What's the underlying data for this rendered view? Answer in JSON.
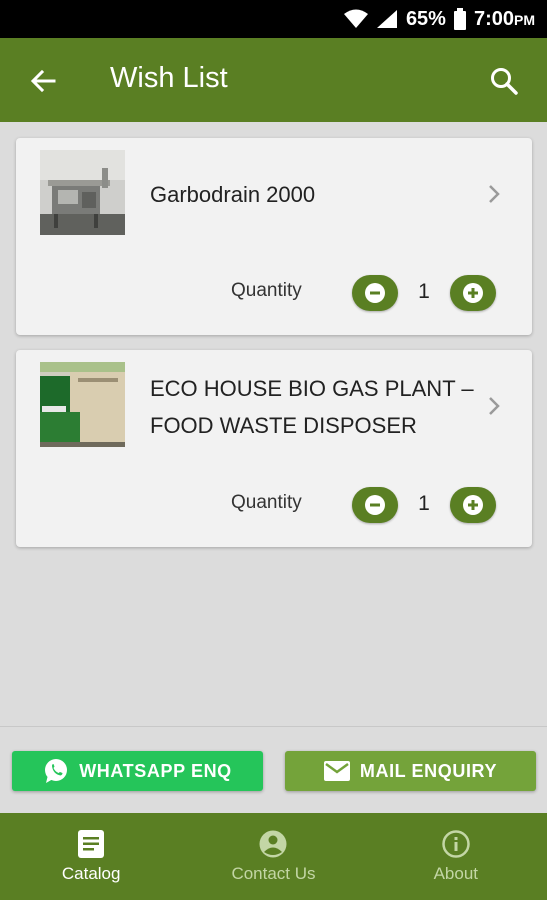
{
  "status_bar": {
    "battery": "65%",
    "time": "7:00",
    "ampm": "PM"
  },
  "app_bar": {
    "title": "Wish List"
  },
  "items": [
    {
      "name": "Garbodrain 2000",
      "quantity_label": "Quantity",
      "quantity": "1"
    },
    {
      "name": "ECO HOUSE BIO GAS PLANT – FOOD WASTE DISPOSER",
      "quantity_label": "Quantity",
      "quantity": "1"
    }
  ],
  "actions": {
    "whatsapp_label": "WHATSAPP ENQ",
    "mail_label": "MAIL ENQUIRY"
  },
  "bottom_nav": [
    {
      "label": "Catalog",
      "icon": "catalog-icon",
      "active": true
    },
    {
      "label": "Contact Us",
      "icon": "account-icon",
      "active": false
    },
    {
      "label": "About",
      "icon": "info-icon",
      "active": false
    }
  ],
  "colors": {
    "primary": "#5a7f23",
    "whatsapp": "#25c55a",
    "mail": "#74a33a"
  }
}
